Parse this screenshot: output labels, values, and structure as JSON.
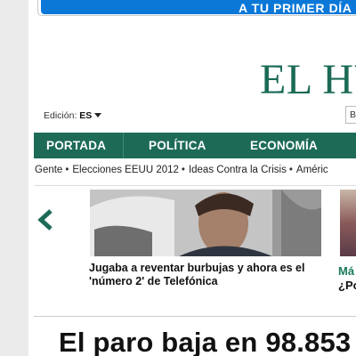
{
  "promo": {
    "button_text": "A TU PRIMER DÍA DE"
  },
  "masthead": {
    "title": "EL HU"
  },
  "edition": {
    "label": "Edición:",
    "value": "ES"
  },
  "search": {
    "placeholder": "B"
  },
  "nav": {
    "items": [
      {
        "label": "PORTADA"
      },
      {
        "label": "POLÍTICA"
      },
      {
        "label": "ECONOMÍA"
      }
    ]
  },
  "tags": {
    "items": [
      {
        "label": "Gente"
      },
      {
        "label": "Elecciones EEUU 2012"
      },
      {
        "label": "Ideas Contra la Crisis"
      },
      {
        "label": "Améric"
      }
    ]
  },
  "carousel": {
    "prev_icon": "chevron-left-icon",
    "story": {
      "title": "Jugaba a reventar burbujas y ahora es el 'número 2' de Telefónica"
    },
    "side_story": {
      "section": "Má",
      "title": "¿Po"
    }
  },
  "headline": {
    "text": "El paro baja en 98.853"
  },
  "colors": {
    "brand_green": "#1d6b57",
    "promo_blue": "#0b78d8",
    "section_green": "#1a7a5c"
  }
}
